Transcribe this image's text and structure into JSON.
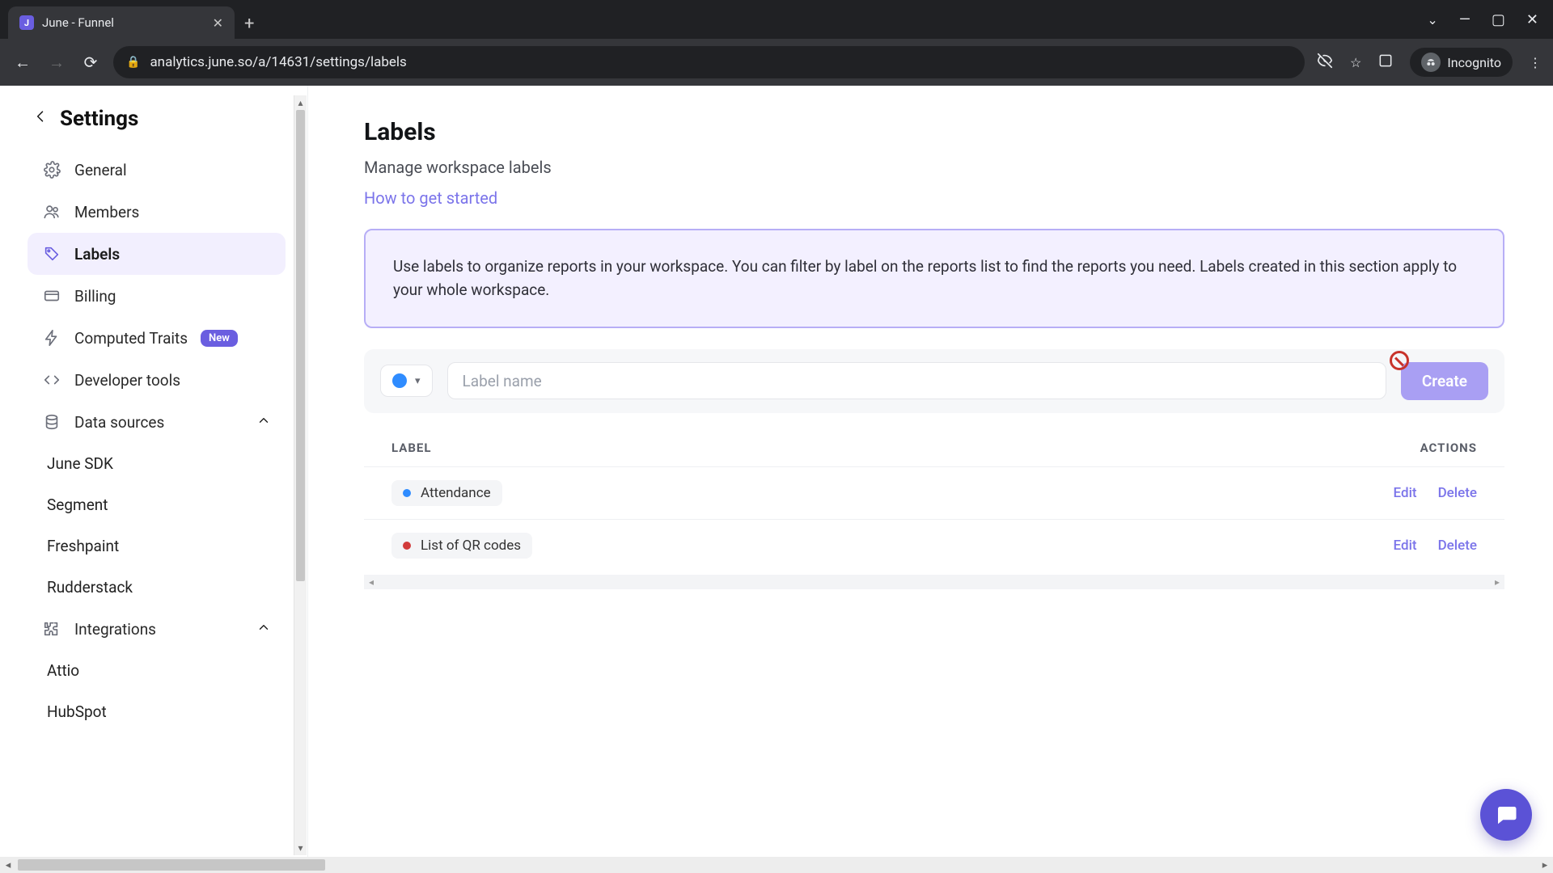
{
  "browser": {
    "tab_title": "June - Funnel",
    "url": "analytics.june.so/a/14631/settings/labels",
    "incognito_label": "Incognito"
  },
  "sidebar": {
    "title": "Settings",
    "items": {
      "general": "General",
      "members": "Members",
      "labels": "Labels",
      "billing": "Billing",
      "computed_traits": "Computed Traits",
      "computed_traits_badge": "New",
      "developer_tools": "Developer tools",
      "data_sources": "Data sources",
      "integrations": "Integrations"
    },
    "data_sources_children": [
      "June SDK",
      "Segment",
      "Freshpaint",
      "Rudderstack"
    ],
    "integrations_children": [
      "Attio",
      "HubSpot"
    ]
  },
  "page": {
    "title": "Labels",
    "subtitle": "Manage workspace labels",
    "how_to": "How to get started",
    "banner": "Use labels to organize reports in your workspace. You can filter by label on the reports list to find the reports you need. Labels created in this section apply to your whole workspace."
  },
  "create": {
    "placeholder": "Label name",
    "button": "Create",
    "swatch_color": "#2f8cff"
  },
  "table": {
    "col_label": "LABEL",
    "col_actions": "ACTIONS",
    "edit": "Edit",
    "delete": "Delete",
    "rows": [
      {
        "name": "Attendance",
        "color": "#2f8cff"
      },
      {
        "name": "List of QR codes",
        "color": "#d23b3b"
      }
    ]
  }
}
